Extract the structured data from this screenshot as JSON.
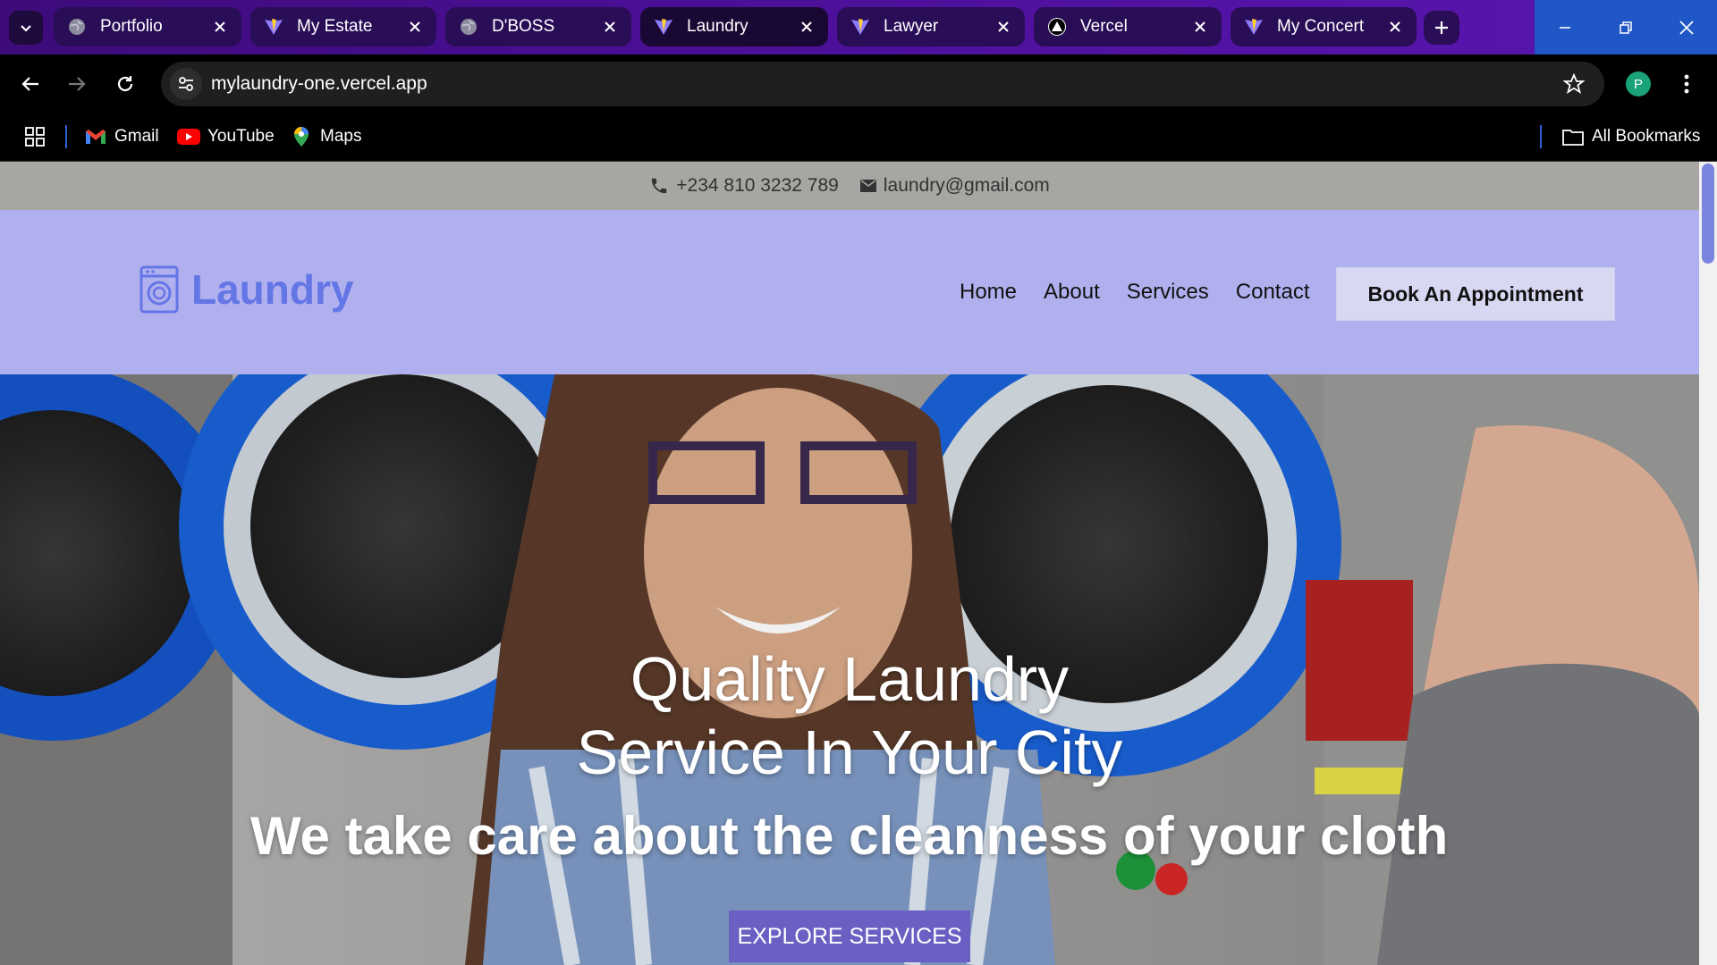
{
  "browser": {
    "tabs": [
      {
        "title": "Portfolio",
        "icon": "globe-icon"
      },
      {
        "title": "My Estate",
        "icon": "vite-icon"
      },
      {
        "title": "D'BOSS",
        "icon": "globe-icon"
      },
      {
        "title": "Laundry",
        "icon": "vite-icon",
        "active": true
      },
      {
        "title": "Lawyer",
        "icon": "vite-icon"
      },
      {
        "title": "Vercel",
        "icon": "vercel-icon"
      },
      {
        "title": "My Concert",
        "icon": "vite-icon"
      }
    ],
    "url": "mylaundry-one.vercel.app",
    "profile_initial": "P",
    "bookmarks": [
      {
        "label": "Gmail",
        "icon": "gmail-icon"
      },
      {
        "label": "YouTube",
        "icon": "youtube-icon"
      },
      {
        "label": "Maps",
        "icon": "maps-icon"
      }
    ],
    "all_bookmarks": "All Bookmarks"
  },
  "page": {
    "topbar": {
      "phone": "+234 810 3232 789",
      "email": "laundry@gmail.com"
    },
    "logo": "Laundry",
    "nav": [
      "Home",
      "About",
      "Services",
      "Contact"
    ],
    "cta": "Book An Appointment",
    "hero": {
      "title_line1": "Quality Laundry",
      "title_line2": "Service In Your City",
      "subtitle": "We take care about the cleanness of your cloth",
      "button": "EXPLORE SERVICES"
    }
  },
  "colors": {
    "header_bg": "#b1b0ef",
    "logo": "#6476e6",
    "topbar_bg": "#a8a6a3",
    "button": "#6b5fc3",
    "window_controls": "#1f57c7"
  }
}
